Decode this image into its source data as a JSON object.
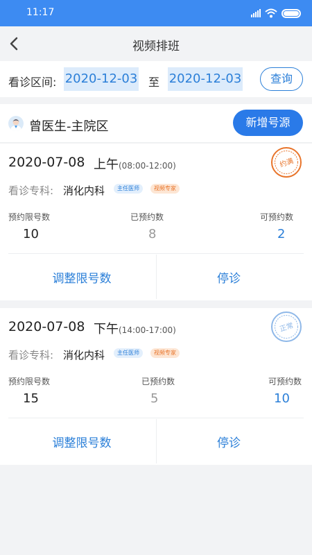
{
  "status_bar": {
    "time": "11:17"
  },
  "nav": {
    "title": "视频排班"
  },
  "filter": {
    "label": "看诊区间:",
    "start_date": "2020-12-03",
    "to": "至",
    "end_date": "2020-12-03",
    "query_label": "查询"
  },
  "doctor": {
    "name": "曾医生-主院区",
    "add_label": "新增号源"
  },
  "cards": [
    {
      "date": "2020-07-08",
      "period": "上午",
      "hours": "(08:00-12:00)",
      "specialty_label": "看诊专科:",
      "specialty": "消化内科",
      "tags": [
        "主任医师",
        "视频专家"
      ],
      "limit_label": "预约限号数",
      "limit": "10",
      "booked_label": "已预约数",
      "booked": "8",
      "available_label": "可预约数",
      "available": "2",
      "stamp": "约满",
      "stamp_color": "#e8742a",
      "adjust_label": "调整限号数",
      "stop_label": "停诊"
    },
    {
      "date": "2020-07-08",
      "period": "下午",
      "hours": "(14:00-17:00)",
      "specialty_label": "看诊专科:",
      "specialty": "消化内科",
      "tags": [
        "主任医师",
        "视频专家"
      ],
      "limit_label": "预约限号数",
      "limit": "15",
      "booked_label": "已预约数",
      "booked": "5",
      "available_label": "可预约数",
      "available": "10",
      "stamp": "正常",
      "stamp_color": "#8fb8e8",
      "adjust_label": "调整限号数",
      "stop_label": "停诊"
    }
  ],
  "colors": {
    "primary": "#2a7ae8",
    "header": "#3d8bf2",
    "full_stamp": "#e8742a",
    "normal_stamp": "#8fb8e8"
  }
}
